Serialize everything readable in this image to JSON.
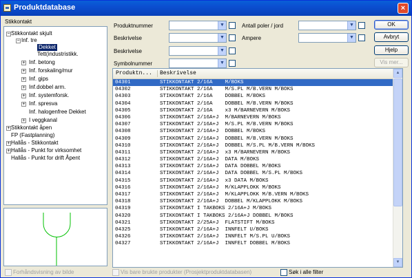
{
  "window": {
    "title": "Produktdatabase",
    "close_glyph": "×"
  },
  "tree": {
    "heading": "Stikkontakt",
    "items": [
      {
        "label": "Stikkontakt skjult",
        "expander": "−"
      },
      {
        "label": "Inf. tre",
        "expander": "−"
      },
      {
        "label": "Dekket",
        "selected": true
      },
      {
        "label": "Tett(industristikk."
      },
      {
        "label": "Inf. betong",
        "expander": "+"
      },
      {
        "label": "Inf. forskaling/mur",
        "expander": "+"
      },
      {
        "label": "Inf. gips",
        "expander": "+"
      },
      {
        "label": "Inf.dobbel arm.",
        "expander": "+"
      },
      {
        "label": "Inf. systemforsk.",
        "expander": "+"
      },
      {
        "label": "Inf. spresva",
        "expander": "+"
      },
      {
        "label": "Inf. halogenfree Dekket"
      },
      {
        "label": "I veggkanal",
        "expander": "+"
      },
      {
        "label": "Stikkontakt åpen",
        "expander": "+"
      },
      {
        "label": "FP (Fastplanning)"
      },
      {
        "label": "Hallås - Stikkontakt",
        "expander": "+"
      },
      {
        "label": "Hallås - Punkt for virksomhet",
        "expander": "+"
      },
      {
        "label": "Hallås - Punkt for drift Åpent"
      }
    ]
  },
  "preview": {
    "checkbox_label": "Forhåndsvisning av bilde"
  },
  "filters": {
    "produktnummer": "Produktnummer",
    "beskrivelse1": "Beskrivelse",
    "beskrivelse2": "Beskrivelse",
    "symbolnummer": "Symbolnummer",
    "antall_poler": "Antall poler / jord",
    "ampere": "Ampere",
    "arrow": "▼"
  },
  "buttons": {
    "ok": "OK",
    "avbryt": "Avbryt",
    "hjelp": "Hjelp",
    "vis_mer": "Vis mer..."
  },
  "table": {
    "columns": [
      "Produktn...",
      "Beskrivelse"
    ],
    "rows": [
      [
        "04301",
        "STIKKONTAKT 2/16A    M/BOKS"
      ],
      [
        "04302",
        "STIKKONTAKT 2/16A    M/S.PL M/B.VERN M/BOKS"
      ],
      [
        "04303",
        "STIKKONTAKT 2/16A    DOBBEL M/BOKS"
      ],
      [
        "04304",
        "STIKKONTAKT 2/16A    DOBBEL M/B.VERN M/BOKS"
      ],
      [
        "04305",
        "STIKKONTAKT 2/16A    x3 M/BARNEVERN M/BOKS"
      ],
      [
        "04306",
        "STIKKONTAKT 2/16A+J  M/BARNEVERN M/BOKS"
      ],
      [
        "04307",
        "STIKKONTAKT 2/16A+J  M/S.PL M/B.VERN M/BOKS"
      ],
      [
        "04308",
        "STIKKONTAKT 2/16A+J  DOBBEL M/BOKS"
      ],
      [
        "04309",
        "STIKKONTAKT 2/16A+J  DOBBEL M/B.VERN M/BOKS"
      ],
      [
        "04310",
        "STIKKONTAKT 2/16A+J  DOBBEL M/S.PL M/B.VERN M/BOKS"
      ],
      [
        "04311",
        "STIKKONTAKT 2/16A+J  x3 M/BARNEVERN M/BOKS"
      ],
      [
        "04312",
        "STIKKONTAKT 2/16A+J  DATA M/BOKS"
      ],
      [
        "04313",
        "STIKKONTAKT 2/16A+J  DATA DOBBEL M/BOKS"
      ],
      [
        "04314",
        "STIKKONTAKT 2/16A+J  DATA DOBBEL M/S.PL M/BOKS"
      ],
      [
        "04315",
        "STIKKONTAKT 2/16A+J  x3 DATA M/BOKS"
      ],
      [
        "04316",
        "STIKKONTAKT 2/16A+J  M/KLAPPLOKK M/BOKS"
      ],
      [
        "04317",
        "STIKKONTAKT 2/16A+J  M/KLAPPLOKK M/B.VERN M/BOKS"
      ],
      [
        "04318",
        "STIKKONTAKT 2/16A+J  DOBBEL M/KLAPPLOKK M/BOKS"
      ],
      [
        "04319",
        "STIKKONTAKT I TAKBOKS 2/16A+J M/BOKS"
      ],
      [
        "04320",
        "STIKKONTAKT I TAKBOKS 2/16A+J DOBBEL M/BOKS"
      ],
      [
        "04321",
        "STIKKONTAKT 2/25A+J  FLATSTIFT M/BOKS"
      ],
      [
        "04325",
        "STIKKONTAKT 2/16A+J  INNFELT U/BOKS"
      ],
      [
        "04326",
        "STIKKONTAKT 2/16A+J  INNFELT M/S.PL U/BOKS"
      ],
      [
        "04327",
        "STIKKONTAKT 2/16A+J  INNFELT DOBBEL M/BOKS"
      ]
    ],
    "selected_index": 0
  },
  "footer": {
    "vis_bare": "Vis bare brukte produkter (Prosjektproduktdatabasen)",
    "sok_alle": "Søk i alle filter"
  },
  "colors": {
    "accent": "#316ac5",
    "titlebar": "#0b4ed0"
  }
}
